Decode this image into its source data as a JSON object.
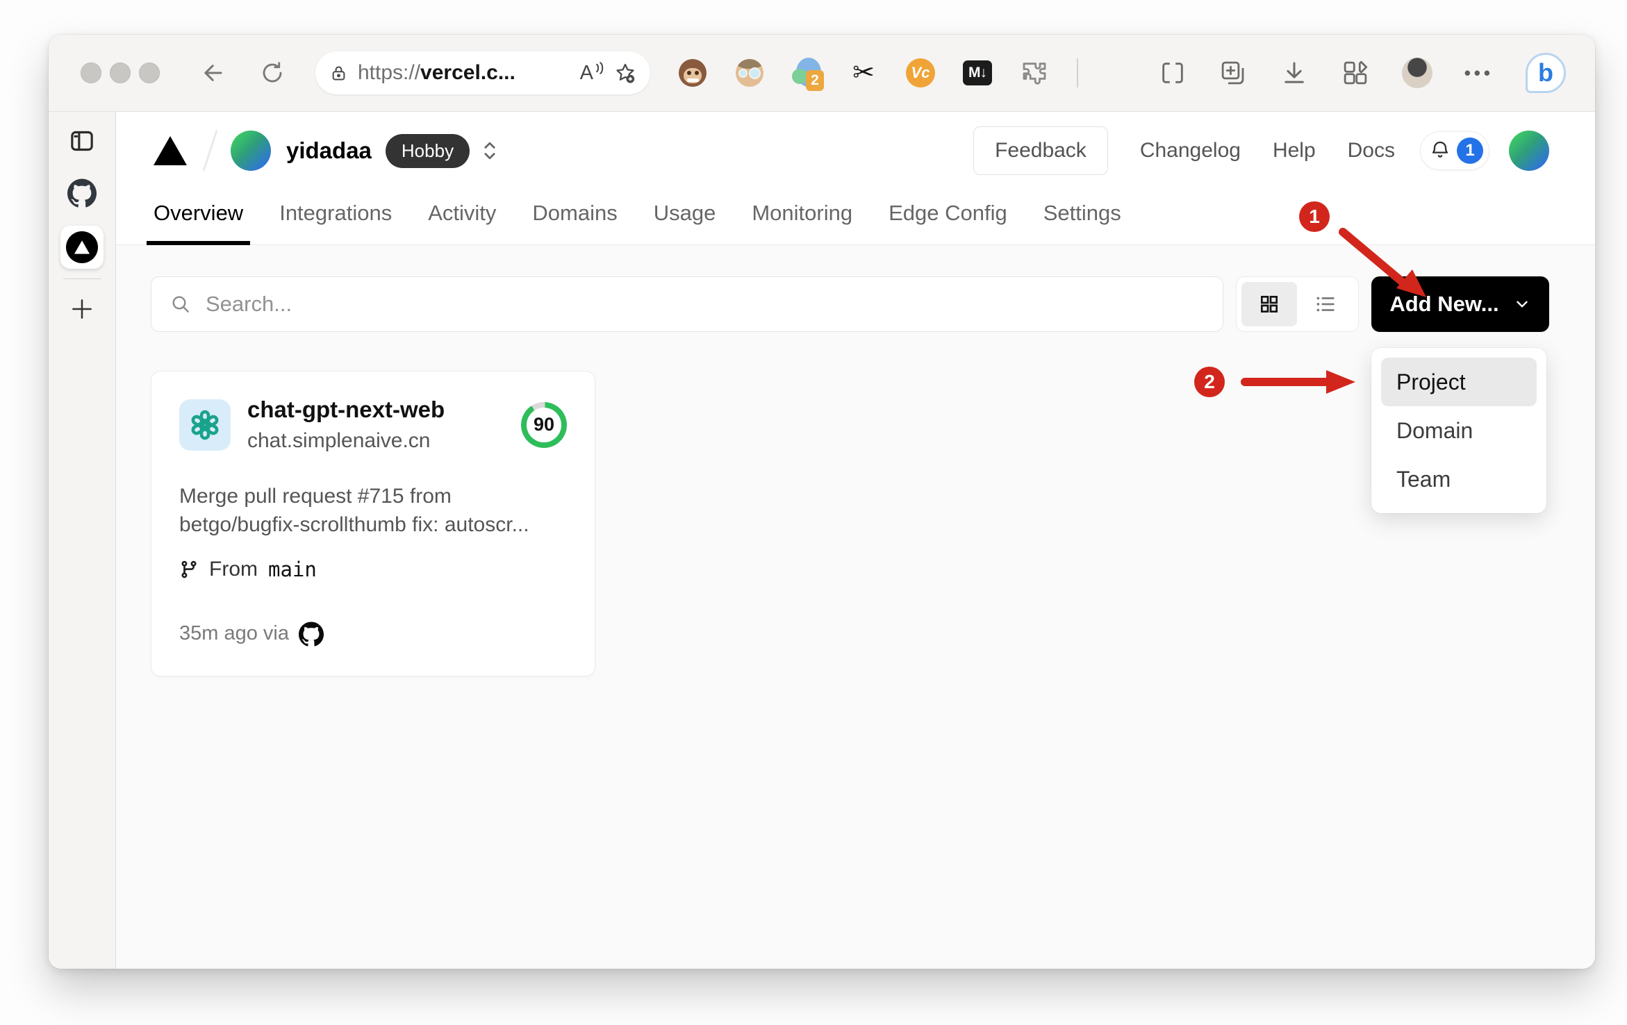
{
  "browser": {
    "url": {
      "scheme": "https://",
      "host": "vercel.c..."
    },
    "read_aloud_label": "A",
    "extensions": {
      "tab_count_badge": "2",
      "vc_label": "Vc",
      "markdown_label": "M↓"
    },
    "more_dots": "•••",
    "bing_label": "b"
  },
  "header": {
    "team_name": "yidadaa",
    "plan_badge": "Hobby",
    "feedback_label": "Feedback",
    "links": [
      {
        "label": "Changelog"
      },
      {
        "label": "Help"
      },
      {
        "label": "Docs"
      }
    ],
    "notification_count": "1"
  },
  "nav": {
    "tabs": [
      {
        "label": "Overview",
        "active": true
      },
      {
        "label": "Integrations"
      },
      {
        "label": "Activity"
      },
      {
        "label": "Domains"
      },
      {
        "label": "Usage"
      },
      {
        "label": "Monitoring"
      },
      {
        "label": "Edge Config"
      },
      {
        "label": "Settings"
      }
    ]
  },
  "toolbar": {
    "search_placeholder": "Search...",
    "add_new_label": "Add New..."
  },
  "project_card": {
    "name": "chat-gpt-next-web",
    "domain": "chat.simplenaive.cn",
    "score": "90",
    "commit_message": {
      "line1": "Merge pull request #715 from",
      "line2": "betgo/bugfix-scrollthumb fix: autoscr..."
    },
    "branch_prefix": "From",
    "branch_name": "main",
    "deployed_text": "35m ago via"
  },
  "dropdown": {
    "items": [
      {
        "label": "Project",
        "selected": true
      },
      {
        "label": "Domain"
      },
      {
        "label": "Team"
      }
    ]
  },
  "annotations": {
    "step1": "1",
    "step2": "2",
    "color": "#d2261c"
  }
}
